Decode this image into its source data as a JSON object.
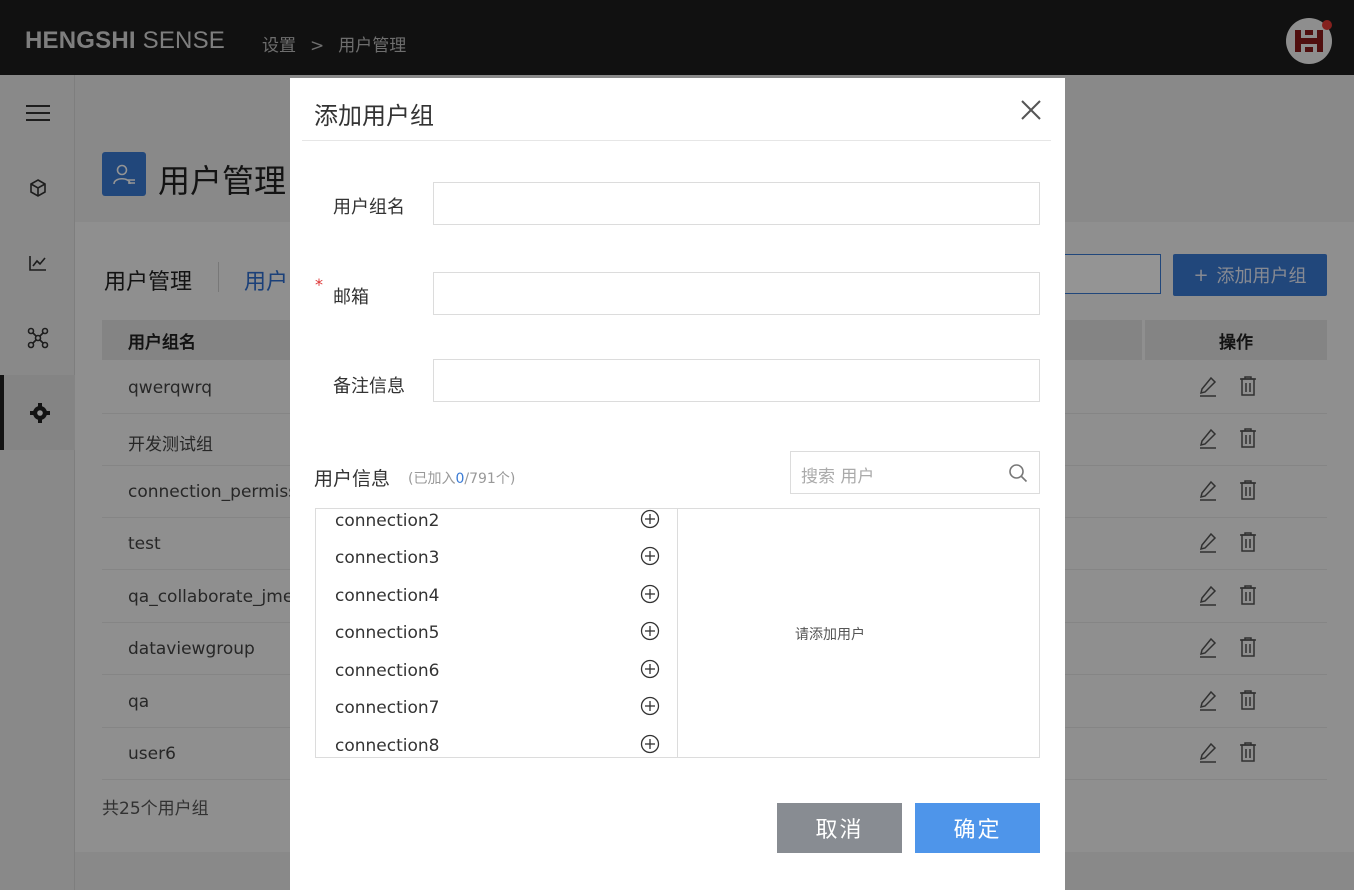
{
  "app": {
    "logo_bold": "HENGSHI",
    "logo_light": "SENSE"
  },
  "breadcrumb": {
    "items": [
      "设置",
      "用户管理"
    ],
    "separator": ">"
  },
  "page": {
    "title": "用户管理",
    "tab_main": "用户管理",
    "tab_sub": "用户",
    "add_button_label": "添加用户组",
    "add_button_icon": "+",
    "table": {
      "columns": [
        "用户组名",
        "操作"
      ],
      "rows": [
        "qwerqwrq",
        "开发测试组",
        "connection_permissio",
        "test",
        "qa_collaborate_jmete",
        "dataviewgroup",
        "qa",
        "user6"
      ]
    },
    "total": "共25个用户组"
  },
  "modal": {
    "title": "添加用户组",
    "required_mark": "*",
    "fields": {
      "group_name_label": "用户组名",
      "email_label": "邮箱",
      "note_label": "备注信息"
    },
    "user_info": {
      "label": "用户信息",
      "count_prefix": "(已加入",
      "count_added": "0",
      "count_suffix": "/791个)",
      "search_placeholder": "搜索 用户",
      "available_users": [
        "connection2",
        "connection3",
        "connection4",
        "connection5",
        "connection6",
        "connection7",
        "connection8"
      ],
      "empty_hint": "请添加用户"
    },
    "cancel_label": "取消",
    "confirm_label": "确定"
  },
  "colors": {
    "accent": "#3a7bd5",
    "confirm": "#4e95ea",
    "cancel": "#888c92",
    "topbar": "#1e1e1e",
    "required": "#d33333"
  }
}
